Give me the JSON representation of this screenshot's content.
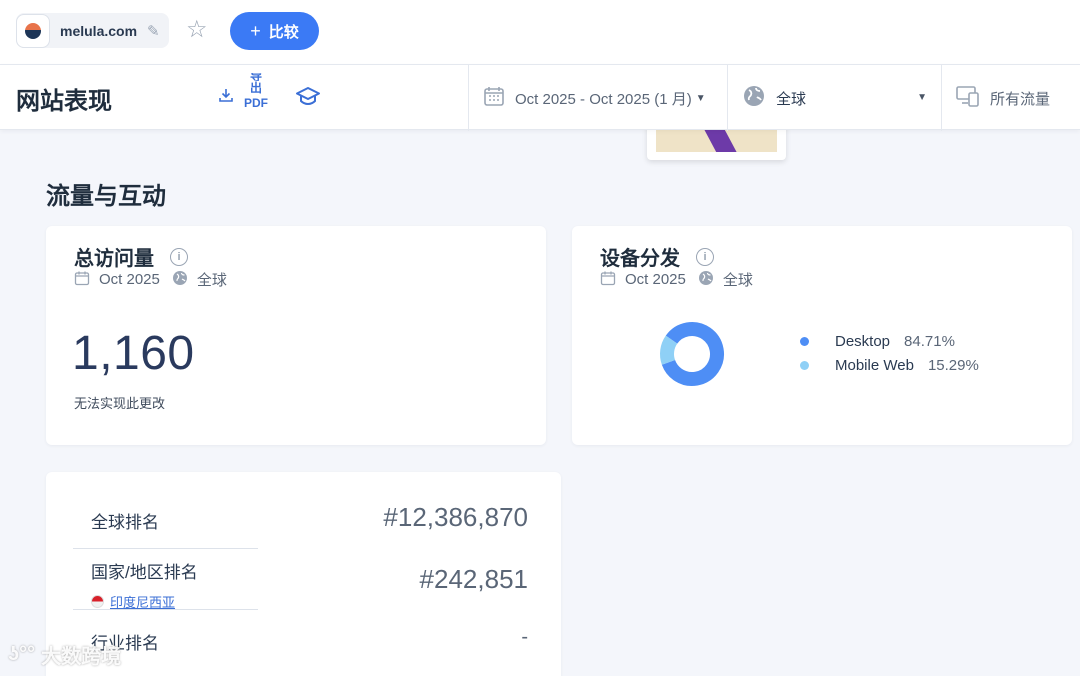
{
  "topbar": {
    "site_name": "melula.com",
    "compare_label": "比较",
    "compare_plus": "+"
  },
  "toolbar": {
    "page_title": "网站表现",
    "export_label_1": "导",
    "export_label_2": "出",
    "export_label_3": "PDF",
    "date_range": "Oct 2025 - Oct 2025 (1 月)",
    "region": "全球",
    "traffic": "所有流量"
  },
  "section": {
    "title": "流量与互动"
  },
  "visits_card": {
    "title": "总访问量",
    "period": "Oct 2025",
    "region": "全球",
    "value": "1,160",
    "note": "无法实现此更改"
  },
  "device_card": {
    "title": "设备分发",
    "period": "Oct 2025",
    "region": "全球",
    "items": [
      {
        "label": "Desktop",
        "pct": "84.71%",
        "value": 84.71,
        "color": "#4e8ef5"
      },
      {
        "label": "Mobile Web",
        "pct": "15.29%",
        "value": 15.29,
        "color": "#8fd0f6"
      }
    ]
  },
  "rank_card": {
    "global_label": "全球排名",
    "global_value": "#12,386,870",
    "country_label": "国家/地区排名",
    "country_name": "印度尼西亚",
    "country_value": "#242,851",
    "industry_label": "行业排名",
    "industry_value": "-"
  },
  "watermark": {
    "text": "大数跨境"
  },
  "colors": {
    "accent": "#3b7af5",
    "link": "#3b6fd6"
  }
}
